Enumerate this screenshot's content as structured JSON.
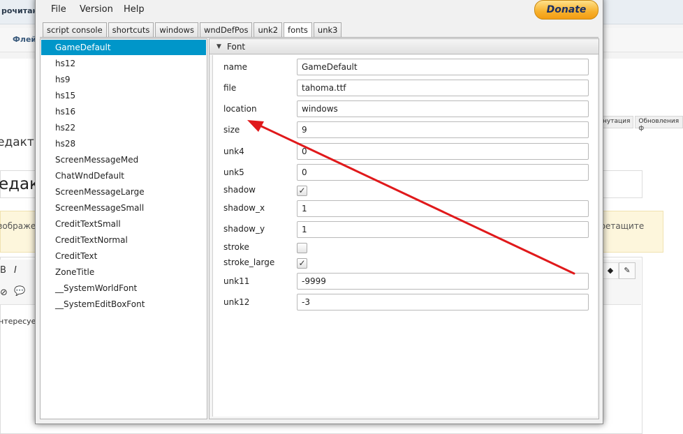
{
  "background": {
    "top_text": "рочитанн",
    "crumb_text": "Флей",
    "heading1": "едакт",
    "heading2": "едакт",
    "notice_left": "зображе",
    "notice_right": "еретащите",
    "tabs": [
      "нутация",
      "Обновления ф"
    ],
    "editor_text": "нтересуе",
    "toolbar_glyphs": [
      "I",
      "💬"
    ]
  },
  "window": {
    "menu": [
      "File",
      "Version",
      "Help"
    ],
    "donate_label": "Donate",
    "tabs": [
      "script console",
      "shortcuts",
      "windows",
      "wndDefPos",
      "unk2",
      "fonts",
      "unk3"
    ],
    "active_tab": "fonts",
    "font_list": [
      "GameDefault",
      "hs12",
      "hs9",
      "hs15",
      "hs16",
      "hs22",
      "hs28",
      "ScreenMessageMed",
      "ChatWndDefault",
      "ScreenMessageLarge",
      "ScreenMessageSmall",
      "CreditTextSmall",
      "CreditTextNormal",
      "CreditText",
      "ZoneTitle",
      "__SystemWorldFont",
      "__SystemEditBoxFont"
    ],
    "selected_font": "GameDefault",
    "section_title": "Font",
    "properties": {
      "name": {
        "label": "name",
        "value": "GameDefault"
      },
      "file": {
        "label": "file",
        "value": "tahoma.ttf"
      },
      "location": {
        "label": "location",
        "value": "windows"
      },
      "size": {
        "label": "size",
        "value": "9"
      },
      "unk4": {
        "label": "unk4",
        "value": "0"
      },
      "unk5": {
        "label": "unk5",
        "value": "0"
      },
      "shadow": {
        "label": "shadow",
        "checked": true
      },
      "shadow_x": {
        "label": "shadow_x",
        "value": "1"
      },
      "shadow_y": {
        "label": "shadow_y",
        "value": "1"
      },
      "stroke": {
        "label": "stroke",
        "checked": false
      },
      "stroke_large": {
        "label": "stroke_large",
        "checked": true
      },
      "unk11": {
        "label": "unk11",
        "value": "-9999"
      },
      "unk12": {
        "label": "unk12",
        "value": "-3"
      }
    },
    "check_glyph": "✓"
  },
  "colors": {
    "selection": "#0096c9",
    "annotation_arrow": "#e0191b",
    "donate_gradient": "#f7b12d"
  }
}
